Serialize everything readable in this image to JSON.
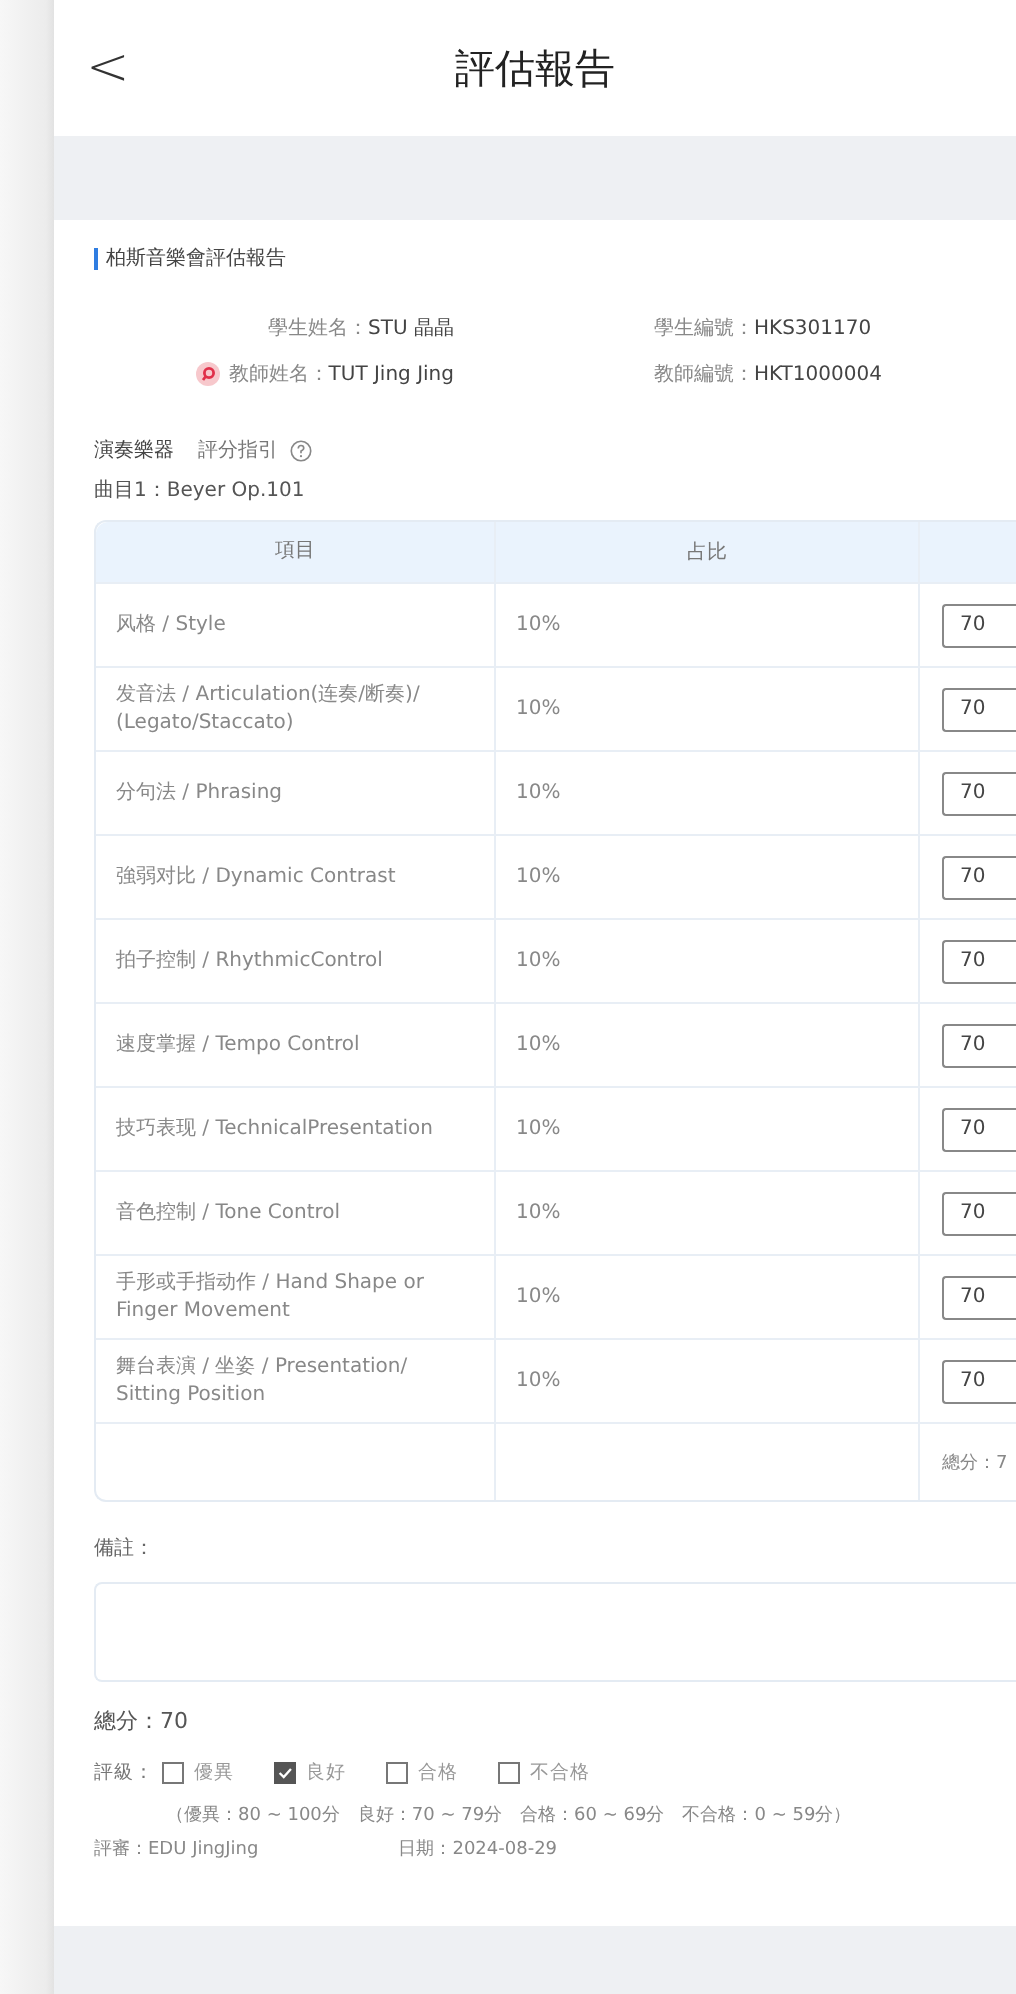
{
  "header": {
    "back": "<",
    "title": "評估報告"
  },
  "report": {
    "title": "柏斯音樂會評估報告",
    "info": [
      {
        "label": "學生姓名：",
        "value": "STU 晶晶"
      },
      {
        "label": "學生編號：",
        "value": "HKS301170"
      },
      {
        "label": "教師姓名：",
        "value": "TUT Jing Jing"
      },
      {
        "label": "教師編號：",
        "value": "HKT1000004"
      }
    ],
    "instrument": "演奏樂器",
    "guide": "評分指引",
    "piece": "曲目1：Beyer Op.101"
  },
  "table": {
    "columns": [
      "項目",
      "占比"
    ],
    "rows": [
      {
        "item": "风格 / Style",
        "weight": "10%",
        "score": "70"
      },
      {
        "item": "发音法 / Articulation(连奏/断奏)/ (Legato/Staccato)",
        "weight": "10%",
        "score": "70"
      },
      {
        "item": "分句法 / Phrasing",
        "weight": "10%",
        "score": "70"
      },
      {
        "item": "強弱对比 / Dynamic Contrast",
        "weight": "10%",
        "score": "70"
      },
      {
        "item": "拍子控制 / RhythmicControl",
        "weight": "10%",
        "score": "70"
      },
      {
        "item": "速度掌握 / Tempo Control",
        "weight": "10%",
        "score": "70"
      },
      {
        "item": "技巧表现 / TechnicalPresentation",
        "weight": "10%",
        "score": "70"
      },
      {
        "item": "音色控制 / Tone Control",
        "weight": "10%",
        "score": "70"
      },
      {
        "item": "手形或手指动作 / Hand Shape or Finger Movement",
        "weight": "10%",
        "score": "70"
      },
      {
        "item": "舞台表演 / 坐姿 / Presentation/ Sitting Position",
        "weight": "10%",
        "score": "70"
      }
    ],
    "total": "總分：7"
  },
  "remarks": {
    "label": "備註："
  },
  "total": "總分：70",
  "grade": {
    "label": "評級：",
    "options": [
      {
        "label": "優異",
        "checked": false
      },
      {
        "label": "良好",
        "checked": true
      },
      {
        "label": "合格",
        "checked": false
      },
      {
        "label": "不合格",
        "checked": false
      }
    ],
    "legend": "（優異：80 ~ 100分　良好：70 ~ 79分　合格：60 ~ 69分　不合格：0 ~ 59分）"
  },
  "reviewer": "評審：EDU JingJing",
  "date": "日期：2024-08-29"
}
